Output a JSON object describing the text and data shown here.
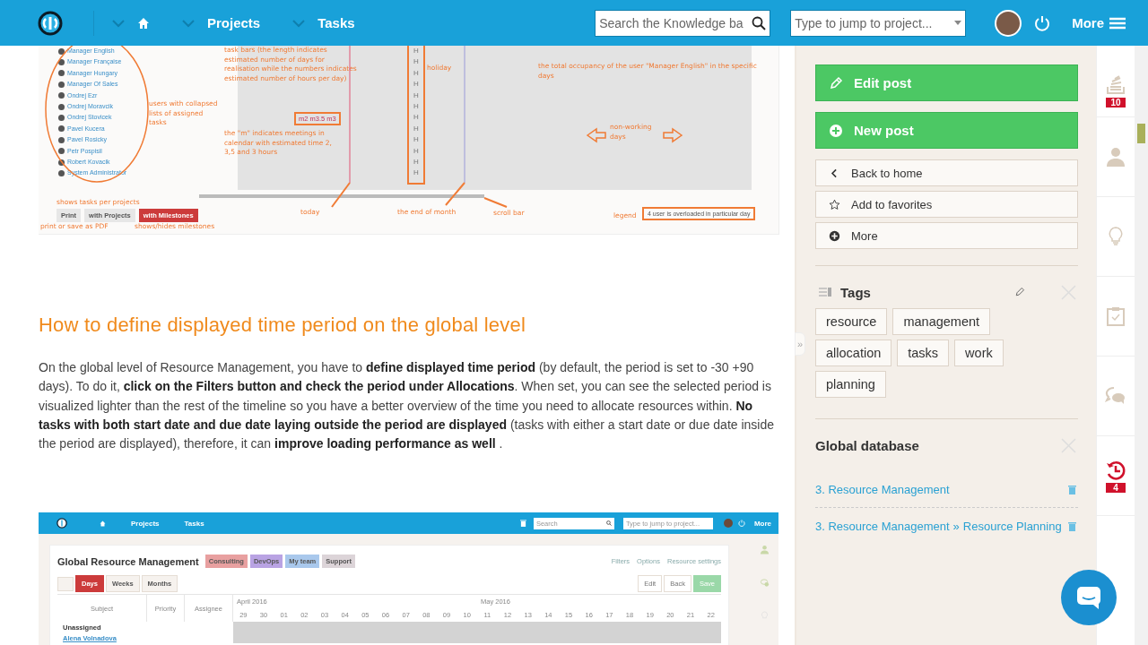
{
  "header": {
    "nav": [
      {
        "kind": "home"
      },
      {
        "kind": "text",
        "label": "Projects"
      },
      {
        "kind": "text",
        "label": "Tasks"
      }
    ],
    "search_placeholder": "Search the Knowledge ba",
    "jump_placeholder": "Type to jump to project...",
    "more": "More"
  },
  "figure_top": {
    "users": [
      "Manager English",
      "Manager Française",
      "Manager Hungary",
      "Manager Of Sales",
      "Ondrej Ezr",
      "Ondrej Moravcik",
      "Ondrej Stovicek",
      "Pavel Kucera",
      "Pavel Rosicky",
      "Petr Pospisil",
      "Robert Kovacik",
      "System Administrator"
    ],
    "holiday_marks": [
      "H",
      "H",
      "H",
      "H",
      "H",
      "H",
      "H",
      "H",
      "H",
      "H",
      "H",
      "H"
    ],
    "notes": [
      "task bars (the length indicates estimated number of days for realisation while the numbers indicates estimated number of hours per day)",
      "users with collapsed lists of assigned tasks",
      "the \"m\" indicates meetings in calendar with estimated time 2, 3,5 and 3 hours",
      "holiday",
      "the total occupancy of the user \"Manager English\" in the specific days",
      "non-working days",
      "today",
      "the end of month",
      "scroll bar",
      "shows tasks per projects",
      "print or save as PDF",
      "shows/hides milestones",
      "legend"
    ],
    "meeting_box": "m2 m3.5 m3",
    "legend_box": "4 user is overloaded in particular day",
    "buttons": [
      {
        "label": "Print",
        "selected": false
      },
      {
        "label": "with Projects",
        "selected": false
      },
      {
        "label": "with Milestones",
        "selected": true
      }
    ]
  },
  "article": {
    "heading": "How to define displayed time period on the global level",
    "paragraph": "On the global level of Resource Management, you have to **define displayed time period** (by default, the period is set to -30 +90 days). To do it, **click on the Filters button and check the period under Allocations**. When set, you can see the selected period is visualized lighter than the rest of the timeline so you have a better overview of the time you need to allocate resources within. **No tasks with both start date and due date laying outside the period are displayed** (tasks with either a start date or due date inside the period are displayed), therefore, it can **improve loading performance as well** ."
  },
  "figure_bottom": {
    "nav": [
      "Projects",
      "Tasks"
    ],
    "search_placeholder": "Search",
    "jump_placeholder": "Type to jump to project...",
    "more": "More",
    "title": "Global Resource Management",
    "tags": [
      {
        "label": "Consulting",
        "color": "#e8a0a0"
      },
      {
        "label": "DevOps",
        "color": "#b9a3e3"
      },
      {
        "label": "My team",
        "color": "#a9c8ec"
      },
      {
        "label": "Support",
        "color": "#dcd4d8"
      }
    ],
    "links": [
      "Filters",
      "Options",
      "Resource settings"
    ],
    "views": [
      {
        "label": "Days",
        "selected": true
      },
      {
        "label": "Weeks",
        "selected": false
      },
      {
        "label": "Months",
        "selected": false
      }
    ],
    "actions": [
      "Edit",
      "Back",
      "Save"
    ],
    "columns": [
      "Subject",
      "Priority",
      "Assignee"
    ],
    "months": [
      "April 2016",
      "May 2016"
    ],
    "days": [
      "29",
      "30",
      "01",
      "02",
      "03",
      "04",
      "05",
      "06",
      "07",
      "08",
      "09",
      "10",
      "11",
      "12",
      "13",
      "14",
      "15",
      "16",
      "17",
      "18",
      "19",
      "20",
      "21",
      "22"
    ],
    "rows": [
      "Unassigned",
      "Alena Volnadova"
    ]
  },
  "sidebar": {
    "actions": [
      {
        "kind": "primary",
        "label": "Edit post"
      },
      {
        "kind": "primary",
        "label": "New post"
      },
      {
        "kind": "secondary",
        "label": "Back to home"
      },
      {
        "kind": "secondary",
        "label": "Add to favorites"
      },
      {
        "kind": "secondary",
        "label": "More"
      }
    ],
    "collapse": "»",
    "tags": {
      "title": "Tags",
      "items": [
        "resource",
        "management",
        "allocation",
        "tasks",
        "work",
        "planning"
      ]
    },
    "database": {
      "title": "Global database",
      "separator": "»",
      "links": [
        {
          "path": [
            "3. Resource Management"
          ]
        },
        {
          "path": [
            "3. Resource Management",
            "Resource Planning"
          ]
        }
      ]
    }
  },
  "rail": {
    "top_badge": "10",
    "bottom_badge": "4"
  }
}
